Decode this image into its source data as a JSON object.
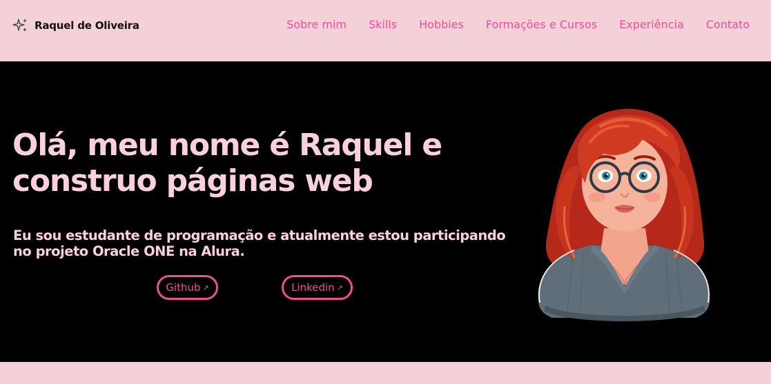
{
  "header": {
    "brand_icon": "sparkles-icon",
    "brand_name": "Raquel de Oliveira",
    "nav": [
      {
        "label": "Sobre mim"
      },
      {
        "label": "Skills"
      },
      {
        "label": "Hobbies"
      },
      {
        "label": "Formações e Cursos"
      },
      {
        "label": "Experiência"
      },
      {
        "label": "Contato"
      }
    ]
  },
  "hero": {
    "headline_line1": "Olá, meu nome é Raquel e",
    "headline_line2": "construo páginas web",
    "lead_line1": "Eu sou estudante de programação e atualmente estou participando",
    "lead_line2": "no projeto Oracle ONE na Alura.",
    "buttons": [
      {
        "label": "Github",
        "icon": "arrow-up-right-icon"
      },
      {
        "label": "Linkedin",
        "icon": "arrow-up-right-icon"
      }
    ],
    "avatar": "illustrated-avatar-red-hair-glasses"
  },
  "colors": {
    "background_pink": "#f4d0d8",
    "hero_background": "#000000",
    "accent_pink": "#ee4f97",
    "headline_pink": "#f9d0dc"
  }
}
